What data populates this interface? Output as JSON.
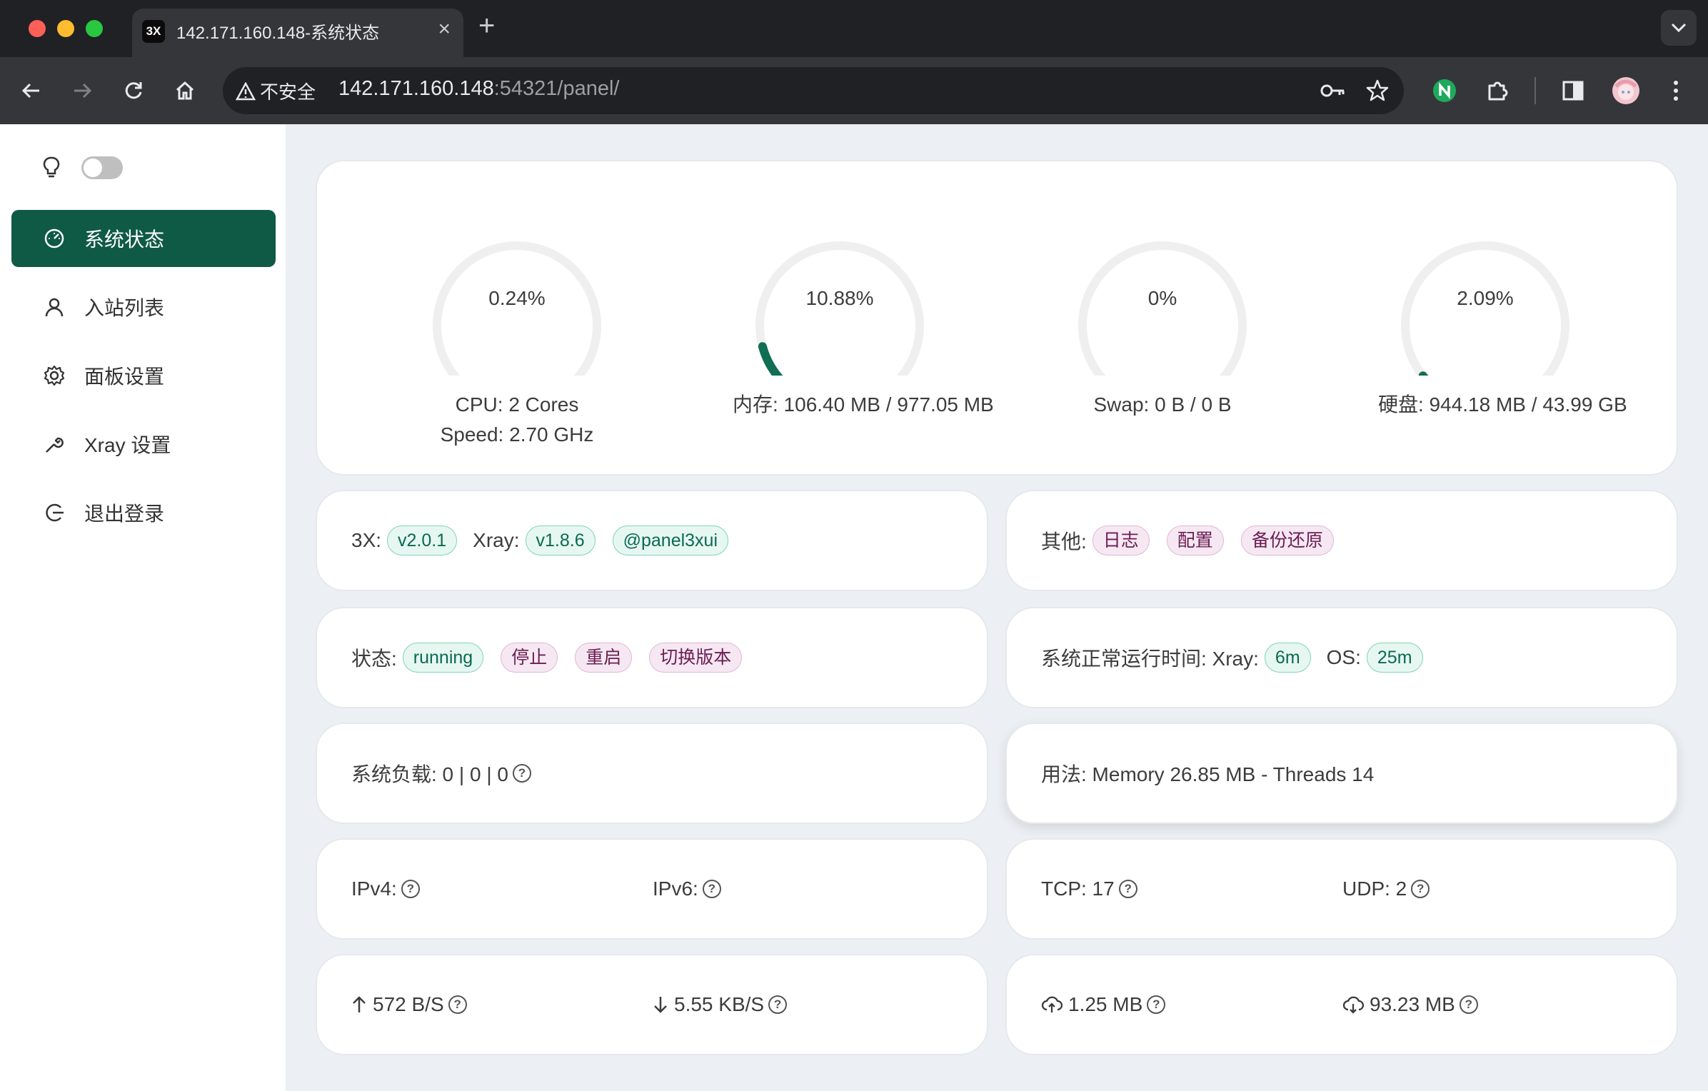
{
  "browser": {
    "tab_favicon": "3X",
    "tab_title": "142.171.160.148-系统状态",
    "insecure_label": "不安全",
    "url_host": "142.171.160.148",
    "url_rest": ":54321/panel/"
  },
  "sidebar": {
    "items": [
      {
        "label": "系统状态",
        "icon": "dashboard-icon"
      },
      {
        "label": "入站列表",
        "icon": "user-icon"
      },
      {
        "label": "面板设置",
        "icon": "gear-icon"
      },
      {
        "label": "Xray 设置",
        "icon": "wrench-icon"
      },
      {
        "label": "退出登录",
        "icon": "logout-icon"
      }
    ]
  },
  "gauges": [
    {
      "value": "0.24%",
      "percent": 0.24,
      "label1": "CPU: 2 Cores",
      "label2": "Speed: 2.70 GHz"
    },
    {
      "value": "10.88%",
      "percent": 10.88,
      "label1": "内存: 106.40 MB / 977.05 MB",
      "label2": ""
    },
    {
      "value": "0%",
      "percent": 0,
      "label1": "Swap: 0 B / 0 B",
      "label2": ""
    },
    {
      "value": "2.09%",
      "percent": 2.09,
      "label1": "硬盘: 944.18 MB / 43.99 GB",
      "label2": ""
    }
  ],
  "versions": {
    "x3_label": "3X:",
    "x3_version": "v2.0.1",
    "xray_label": "Xray:",
    "xray_version": "v1.8.6",
    "channel": "@panel3xui"
  },
  "other": {
    "label": "其他:",
    "logs": "日志",
    "config": "配置",
    "backup": "备份还原"
  },
  "xray_status": {
    "label": "状态:",
    "state": "running",
    "stop": "停止",
    "restart": "重启",
    "switch": "切换版本"
  },
  "uptime": {
    "label": "系统正常运行时间: Xray:",
    "xray": "6m",
    "os_label": "OS:",
    "os": "25m"
  },
  "load": {
    "text": "系统负载: 0 | 0 | 0"
  },
  "usage": {
    "text": "用法: Memory 26.85 MB - Threads 14"
  },
  "ip": {
    "ipv4": "IPv4:",
    "ipv6": "IPv6:"
  },
  "conn": {
    "tcp": "TCP: 17",
    "udp": "UDP: 2"
  },
  "speed": {
    "up": "572 B/S",
    "down": "5.55 KB/S"
  },
  "traffic": {
    "sent": "1.25 MB",
    "received": "93.23 MB"
  },
  "colors": {
    "accent": "#0f6e54",
    "sidebar_active": "#0f5a44",
    "background": "#eceff3"
  }
}
